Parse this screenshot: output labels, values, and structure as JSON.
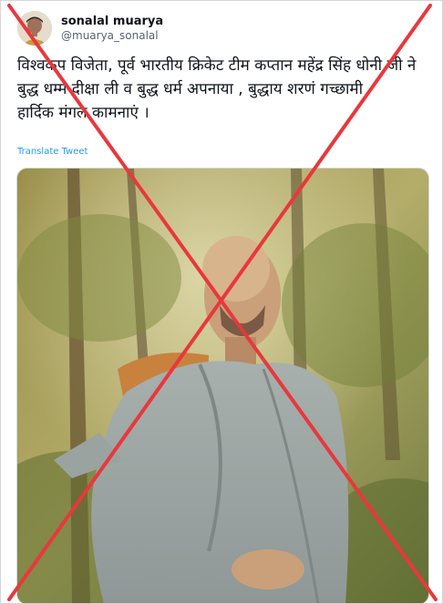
{
  "tweet": {
    "author": {
      "display_name": "sonalal muarya",
      "handle": "@muarya_sonalal"
    },
    "text": "विश्वकप विजेता, पूर्व भारतीय क्रिकेट टीम कप्तान महेंद्र सिंह धोनी जी  ने बुद्ध धम्म दीक्षा ली व बुद्ध धर्म अपनाया , बुद्धाय शरणं गच्छामी\n हार्दिक मंगल कामनाएं ।",
    "translate_label": "Translate Tweet",
    "media": {
      "icon": "monk-photo-icon"
    }
  },
  "overlay": {
    "icon": "false-claim-cross-icon",
    "color": "#e8383c"
  }
}
